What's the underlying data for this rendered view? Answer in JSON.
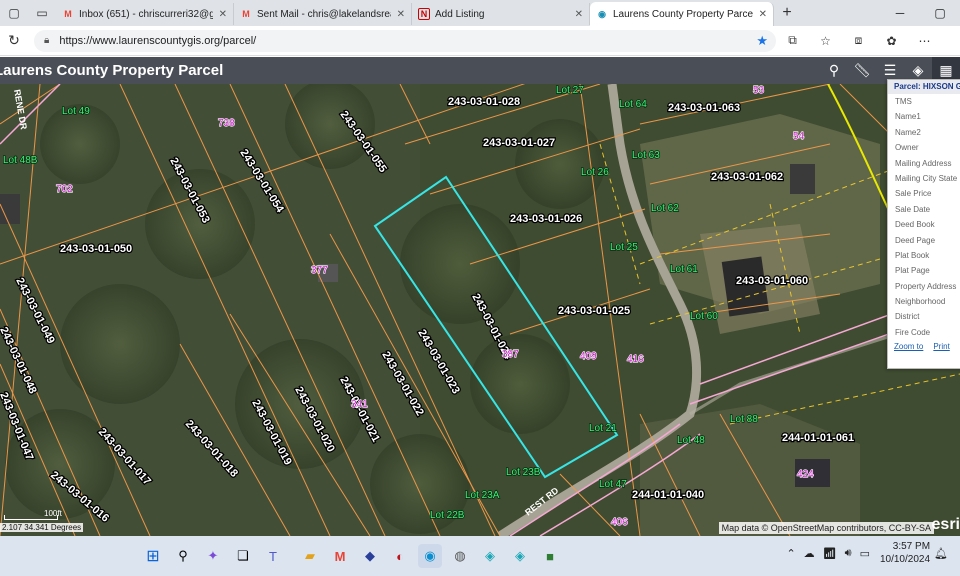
{
  "browser": {
    "tabs": [
      {
        "title": "Inbox (651) - chriscurreri32@gmail.com",
        "favicon": "M",
        "fav_color": "#ea4335",
        "active": false
      },
      {
        "title": "Sent Mail - chris@lakelandsrealty.com",
        "favicon": "M",
        "fav_color": "#ea4335",
        "active": false
      },
      {
        "title": "Add Listing",
        "favicon": "N",
        "fav_color": "#c00",
        "active": false
      },
      {
        "title": "Laurens County Property Parcel",
        "favicon": "◉",
        "fav_color": "#1a8fb4",
        "active": true
      }
    ],
    "url": "https://www.laurenscountygis.org/parcel/"
  },
  "app": {
    "title": "Laurens County Property Parcel",
    "tools": [
      "search-icon",
      "measure-icon",
      "list-icon",
      "layers-icon",
      "grid-icon"
    ]
  },
  "map": {
    "parcels": [
      "243-03-01-028",
      "243-03-01-063",
      "243-03-01-027",
      "243-03-01-055",
      "243-03-01-062",
      "243-03-01-054",
      "243-03-01-053",
      "243-03-01-026",
      "243-03-01-050",
      "243-03-01-060",
      "243-03-01-049",
      "243-03-01-025",
      "243-03-01-024",
      "243-03-01-048",
      "243-03-01-023",
      "243-03-01-022",
      "243-03-01-047",
      "243-03-01-021",
      "243-03-01-020",
      "243-03-01-019",
      "243-03-01-018",
      "243-03-01-017",
      "243-03-01-016",
      "244-01-01-061",
      "244-01-01-040"
    ],
    "lots": [
      "Lot 49",
      "Lot 27",
      "Lot 64",
      "Lot 63",
      "Lot 26",
      "Lot 62",
      "Lot 25",
      "Lot 61",
      "Lot 60",
      "Lot 88",
      "Lot 21",
      "Lot 48",
      "Lot 23B",
      "Lot 47",
      "Lot 23A",
      "Lot 22B",
      "Lot 48B"
    ],
    "numbers": [
      "738",
      "702",
      "377",
      "387",
      "409",
      "416",
      "341",
      "424",
      "406",
      "54",
      "53"
    ],
    "road_labels": [
      "RENE DR",
      "REST RD"
    ],
    "attribution": "Map data © OpenStreetMap contributors, CC-BY-SA",
    "coordinates": "2.107 34.341 Degrees",
    "scale_label": "100ft",
    "logo": "esri"
  },
  "info_panel": {
    "header": "Parcel: HIXSON G",
    "fields": [
      "TMS",
      "Name1",
      "Name2",
      "Owner",
      "Mailing Address",
      "Mailing City State",
      "Sale Price",
      "Sale Date",
      "Deed Book",
      "Deed Page",
      "Plat Book",
      "Plat Page",
      "Property Address",
      "Neighborhood",
      "District",
      "Fire Code"
    ],
    "zoom_link": "Zoom to",
    "print_link": "Print"
  },
  "taskbar": {
    "time": "3:57 PM",
    "date": "10/10/2024"
  }
}
